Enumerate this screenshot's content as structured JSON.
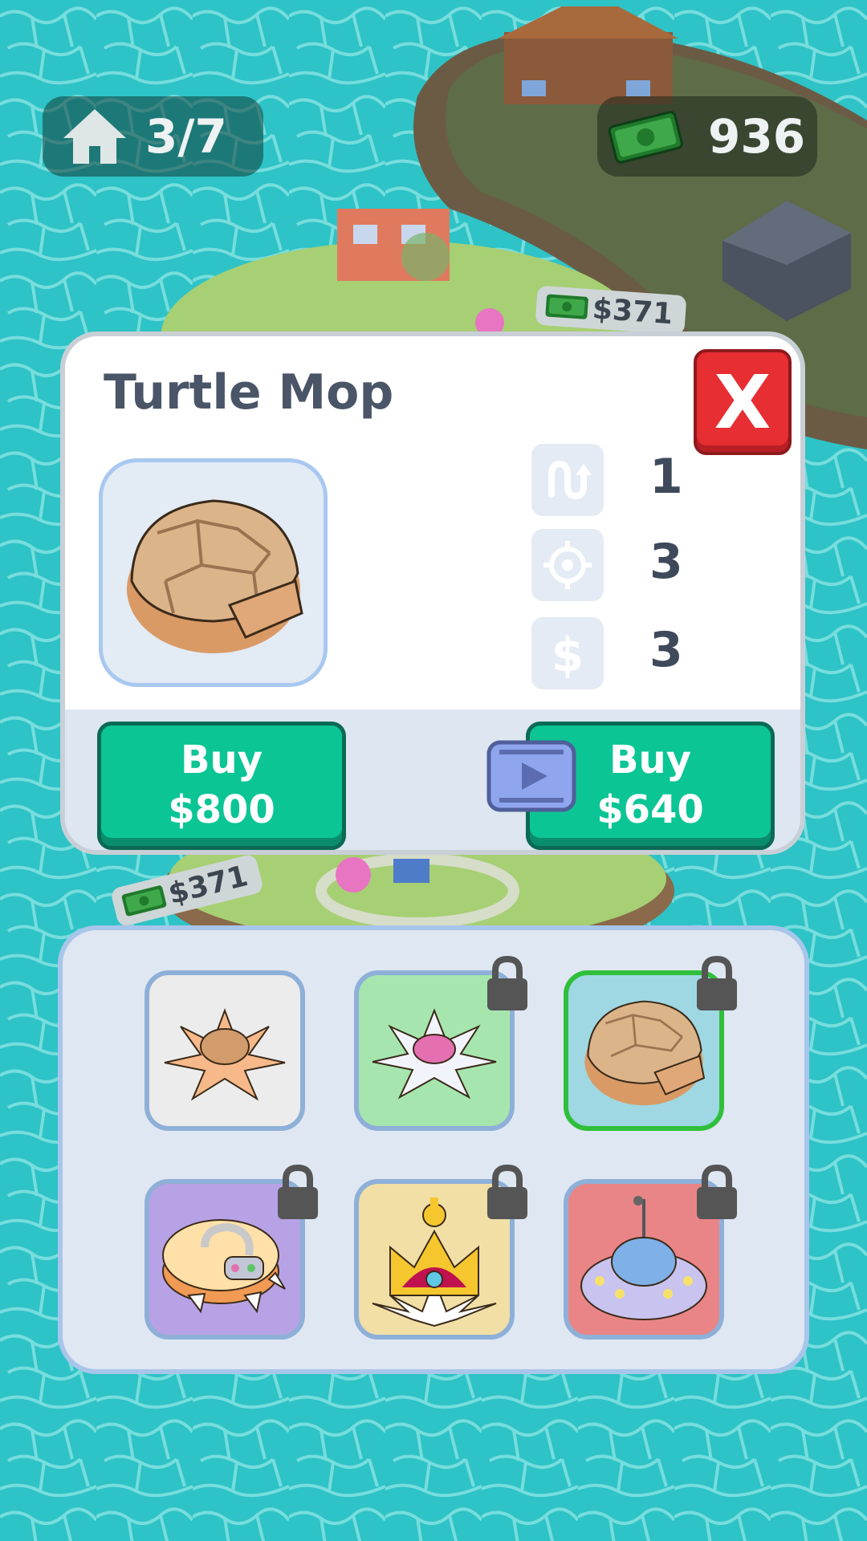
{
  "hud": {
    "houses": "3/7",
    "money": "936"
  },
  "world_tags": {
    "tag_top": "$371",
    "tag_bottom": "$371"
  },
  "popup": {
    "title": "Turtle Mop",
    "close_label": "X",
    "stats": [
      {
        "icon": "path-arrow-icon",
        "value": "1"
      },
      {
        "icon": "target-icon",
        "value": "3"
      },
      {
        "icon": "dollar-icon",
        "value": "3"
      }
    ],
    "buy_button": {
      "line1": "Buy",
      "line2": "$800"
    },
    "buy_ad_button": {
      "line1": "Buy",
      "line2": "$640"
    }
  },
  "items": [
    {
      "name": "peach-mop",
      "color": "#ececec",
      "locked": false,
      "selected": false
    },
    {
      "name": "daisy-mop",
      "color": "#a6e6ae",
      "locked": true,
      "selected": false
    },
    {
      "name": "turtle-mop",
      "color": "#9fd8e2",
      "locked": true,
      "selected": true
    },
    {
      "name": "robot-mop",
      "color": "#b8a2e6",
      "locked": true,
      "selected": false
    },
    {
      "name": "crown-mop",
      "color": "#f1dfa6",
      "locked": true,
      "selected": false
    },
    {
      "name": "ufo-mop",
      "color": "#e98586",
      "locked": true,
      "selected": false
    }
  ]
}
